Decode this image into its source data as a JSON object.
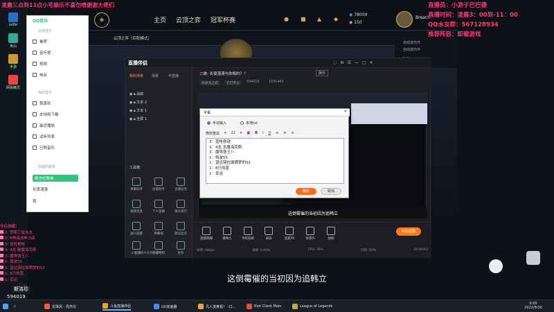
{
  "stream": {
    "top_banner": "凌晨三点到11点小号娱乐不喜勿喷谢谢大佬们",
    "host_line": "直播员：小游子巴巴德",
    "time_line": "直播时间：凌晨3：00到-11：00",
    "qq_line": "QQ水友群：567128934",
    "recommend_line": "推荐阵容：卸载游戏",
    "subtitle": "这倒霉催的当初因为追韩立",
    "left_header": "今日战绩：",
    "left_list": [
      "1: 罗斯三星吉吉",
      "2: 8神追战神马鹃",
      "3: 冒险男枪",
      "4: 4龙 破魔海克斯",
      "3: 魔导铁王八",
      "1: 铁波55",
      "1: 望远镜拉面晒梦的S1",
      "1: 8只炫蓝",
      "1: 幸运"
    ],
    "room_id": "594019",
    "brand_label": "斯洛珍"
  },
  "desktop": {
    "icons": [
      "iodle",
      "米山",
      "手游",
      "网易精灵"
    ]
  },
  "lol": {
    "nav": [
      "主页",
      "云顶之弈",
      "冠军杯赛"
    ],
    "currency_be": "78009",
    "currency_rp": "150",
    "mode_label": "云顶之弈（匹配模式）",
    "user_name": "Breach",
    "side_texts": [
      "自动流光环",
      "自动流光环",
      "群聊"
    ]
  },
  "music": {
    "logo": "QQ音乐",
    "section_online": "在线音乐",
    "online_items": [
      "推荐",
      "音乐馆",
      "视频",
      "电台"
    ],
    "section_mine": "我的音乐",
    "mine_items": [
      "我喜欢",
      "本地和下载",
      "最近播放",
      "试听列表",
      "已购音乐"
    ],
    "section_created": "创建的歌单",
    "created_items": [
      "周杰伦歌单",
      "长夜漫漫",
      "我"
    ]
  },
  "companion": {
    "app_title": "直播伴侣",
    "tabs": [
      "我的场景",
      "场景",
      "可直播"
    ],
    "layers": [
      "战绩",
      "文本 2",
      "文本 1",
      "全屏 1"
    ],
    "tools_header": "工具箱",
    "tools": [
      "弹幕助手",
      "房管助手",
      "主播任务",
      "视频连麦",
      "个人直播",
      "观众排行",
      "送礼提醒",
      "弹幕墙",
      "歌词显示",
      "一起看",
      "高能时刻",
      "更多"
    ],
    "room_title": "二故: 长夜漫漫与你相约？！",
    "room_tag": "娱乐",
    "room_meta1": "乐段云之弈",
    "room_meta2": "它打开小",
    "room_id": "594019",
    "room_fans": "1501443",
    "controls": [
      "直播演播",
      "摄像头",
      "手机投屏",
      "录屏",
      "连麦PK",
      "背景声",
      "拍照"
    ],
    "start_button": "开始直播",
    "stats": [
      "码率: 0kbps",
      "丢帧: 0.00%",
      "CPU: 36%",
      "内存: 64%",
      "00:00:03"
    ],
    "notice": "3.各直播中说明的事项",
    "preview_subtitle": "这倒霉催的当初因为追韩立"
  },
  "dialog": {
    "title": "字幕",
    "radio_manual": "手动输入",
    "radio_file": "本地txt",
    "font_name": "微软雅黑",
    "font_size": "22",
    "lines": [
      "3：蓝枪勃锐",
      "3：4龙 龙魔海克斯",
      "3：魔导铁王八",
      "1：鸭波55",
      "1：望远镜拉面晒梦的S1",
      "1：8只炫蓝",
      "1：幸运"
    ],
    "ok": "确定",
    "cancel": "取消"
  },
  "taskbar": {
    "items": [
      "龙珠风 - 周杰伦",
      "斗鱼直播伴侣",
      "UU加速器",
      "凡人流鼻祖！ -口...",
      "Riot Client Main",
      "League of Legends"
    ],
    "clock_time": "9:00",
    "clock_date": "2022/8/30",
    "colors": [
      "#ff5a3c",
      "#e8a317",
      "#3c8bff",
      "#f0a04a",
      "#e84c3d",
      "#c8a846"
    ]
  }
}
